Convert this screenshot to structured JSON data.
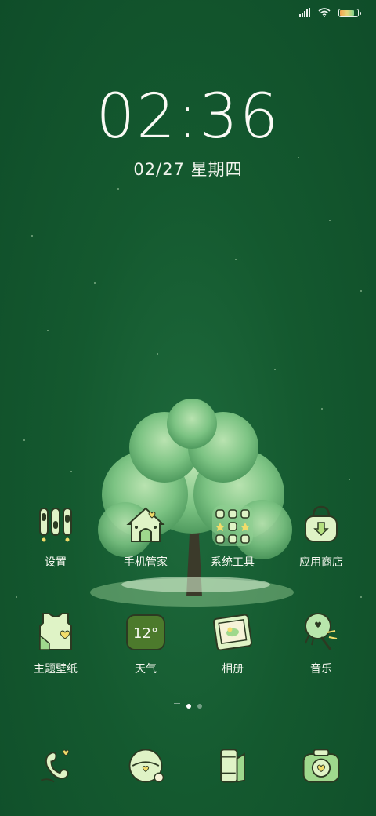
{
  "status_bar": {
    "signal_icon": "signal-bars-icon",
    "wifi_icon": "wifi-icon",
    "battery_icon": "battery-icon",
    "battery_level": 0.8
  },
  "lock": {
    "time": "02:36",
    "date": "02/27 星期四"
  },
  "apps": [
    {
      "label": "设置",
      "icon": "settings-icon"
    },
    {
      "label": "手机管家",
      "icon": "phone-manager-icon"
    },
    {
      "label": "系统工具",
      "icon": "system-tools-folder-icon"
    },
    {
      "label": "应用商店",
      "icon": "app-store-icon"
    },
    {
      "label": "主题壁纸",
      "icon": "themes-icon"
    },
    {
      "label": "天气",
      "icon": "weather-icon",
      "temperature": "12°"
    },
    {
      "label": "相册",
      "icon": "gallery-icon"
    },
    {
      "label": "音乐",
      "icon": "music-icon"
    }
  ],
  "page_indicator": {
    "pages": 2,
    "current": 1
  },
  "dock": [
    {
      "icon": "phone-icon"
    },
    {
      "icon": "messages-icon"
    },
    {
      "icon": "browser-icon"
    },
    {
      "icon": "camera-icon"
    }
  ],
  "colors": {
    "background": "#14592f",
    "icon_fill": "#dff3c6",
    "icon_outline": "#2c3a22",
    "accent": "#8fd59a"
  }
}
